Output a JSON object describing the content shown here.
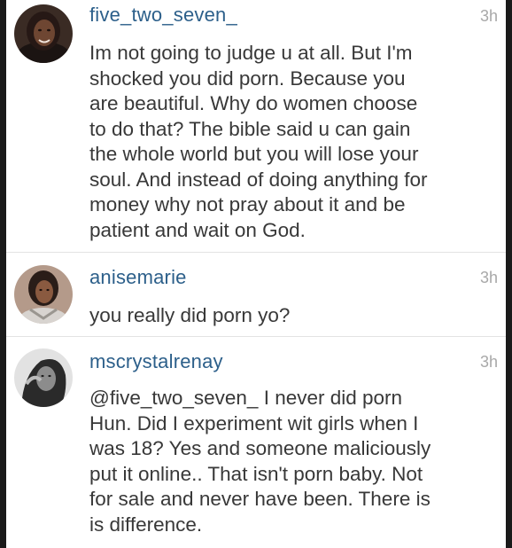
{
  "comments": [
    {
      "username": "five_two_seven_",
      "time": "3h",
      "avatar_icon": "profile-photo",
      "lines": [
        "Im not going to judge u at all. But I'm",
        "shocked you did porn. Because you",
        "are beautiful. Why do women choose",
        "to do that? The bible said u can gain",
        "the whole world but you will lose your",
        "soul. And instead of doing anything for",
        "money why not pray about it and be",
        "patient and wait on God."
      ]
    },
    {
      "username": "anisemarie",
      "time": "3h",
      "avatar_icon": "profile-photo",
      "lines": [
        "you really did porn yo?"
      ]
    },
    {
      "username": "mscrystalrenay",
      "time": "3h",
      "avatar_icon": "profile-photo",
      "lines": [
        "@five_two_seven_ I never did porn",
        "Hun. Did I experiment wit girls when I",
        "was 18? Yes and someone maliciously",
        "put it online.. That isn't porn baby. Not",
        "for sale and never have been. There is",
        "is difference."
      ]
    }
  ],
  "colors": {
    "username": "#2c5f8a",
    "body_text": "#383838",
    "timestamp": "#a8a8a8",
    "divider": "#e3e3e3"
  }
}
